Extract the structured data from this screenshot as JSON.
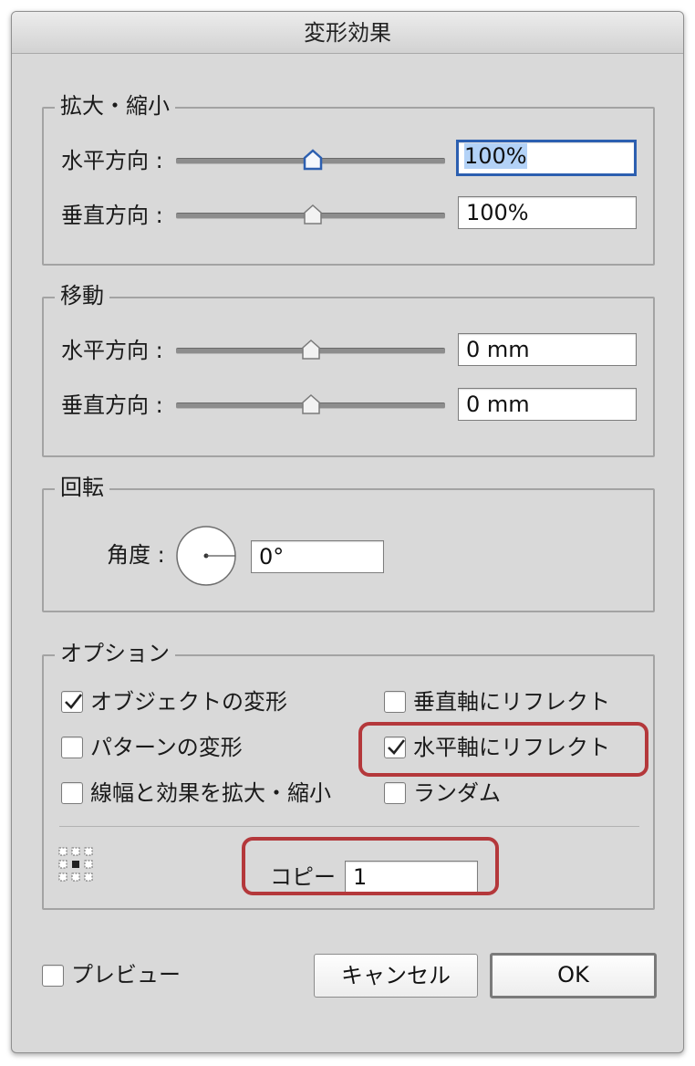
{
  "dialog": {
    "title": "変形効果"
  },
  "scale": {
    "legend": "拡大・縮小",
    "horizontal": {
      "label": "水平方向 :",
      "value": "100%",
      "slider": 0.5
    },
    "vertical": {
      "label": "垂直方向 :",
      "value": "100%",
      "slider": 0.5
    }
  },
  "move": {
    "legend": "移動",
    "horizontal": {
      "label": "水平方向 :",
      "value": "0 mm",
      "slider": 0.5
    },
    "vertical": {
      "label": "垂直方向 :",
      "value": "0 mm",
      "slider": 0.5
    }
  },
  "rotate": {
    "legend": "回転",
    "angle_label": "角度 :",
    "angle_value": "0°"
  },
  "options": {
    "legend": "オプション",
    "transform_objects": {
      "label": "オブジェクトの変形",
      "checked": true
    },
    "transform_patterns": {
      "label": "パターンの変形",
      "checked": false
    },
    "scale_strokes": {
      "label": "線幅と効果を拡大・縮小",
      "checked": false
    },
    "reflect_vertical": {
      "label": "垂直軸にリフレクト",
      "checked": false
    },
    "reflect_horizontal": {
      "label": "水平軸にリフレクト",
      "checked": true
    },
    "random": {
      "label": "ランダム",
      "checked": false
    },
    "copies_label": "コピー",
    "copies_value": "1"
  },
  "footer": {
    "preview": {
      "label": "プレビュー",
      "checked": false
    },
    "cancel_label": "キャンセル",
    "ok_label": "OK"
  },
  "colors": {
    "highlight": "#b4383b",
    "focus": "#2c5fb0",
    "selection": "#b3d2f7"
  }
}
